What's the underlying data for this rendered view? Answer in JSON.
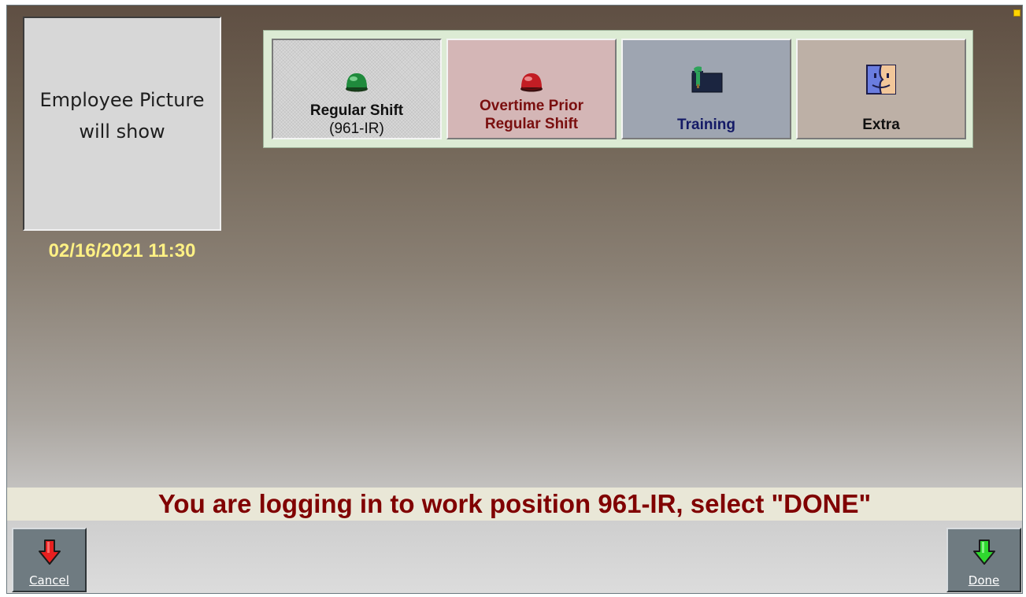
{
  "photo": {
    "placeholder_line1": "Employee Picture",
    "placeholder_line2": "will show"
  },
  "datetime": "02/16/2021 11:30",
  "shifts": [
    {
      "line1": "Regular Shift",
      "line2": "(961-IR)",
      "icon": "green-light-icon",
      "color": "#d8d8d8",
      "selected": true
    },
    {
      "line1": "Overtime Prior",
      "line2": "Regular Shift",
      "icon": "red-light-icon",
      "color": "#d4b6b6",
      "selected": false
    },
    {
      "line1": "Training",
      "icon": "training-folder-icon",
      "color": "#9ea5b1",
      "selected": false
    },
    {
      "line1": "Extra",
      "icon": "finder-face-icon",
      "color": "#bdb0a6",
      "selected": false
    }
  ],
  "message": "You are logging in to work position 961-IR, select \"DONE\"",
  "buttons": {
    "cancel_label": "Cancel",
    "done_label": "Done"
  },
  "colors": {
    "message_text": "#800000",
    "datetime_text": "#fff184",
    "status_indicator": "#ffd400"
  }
}
